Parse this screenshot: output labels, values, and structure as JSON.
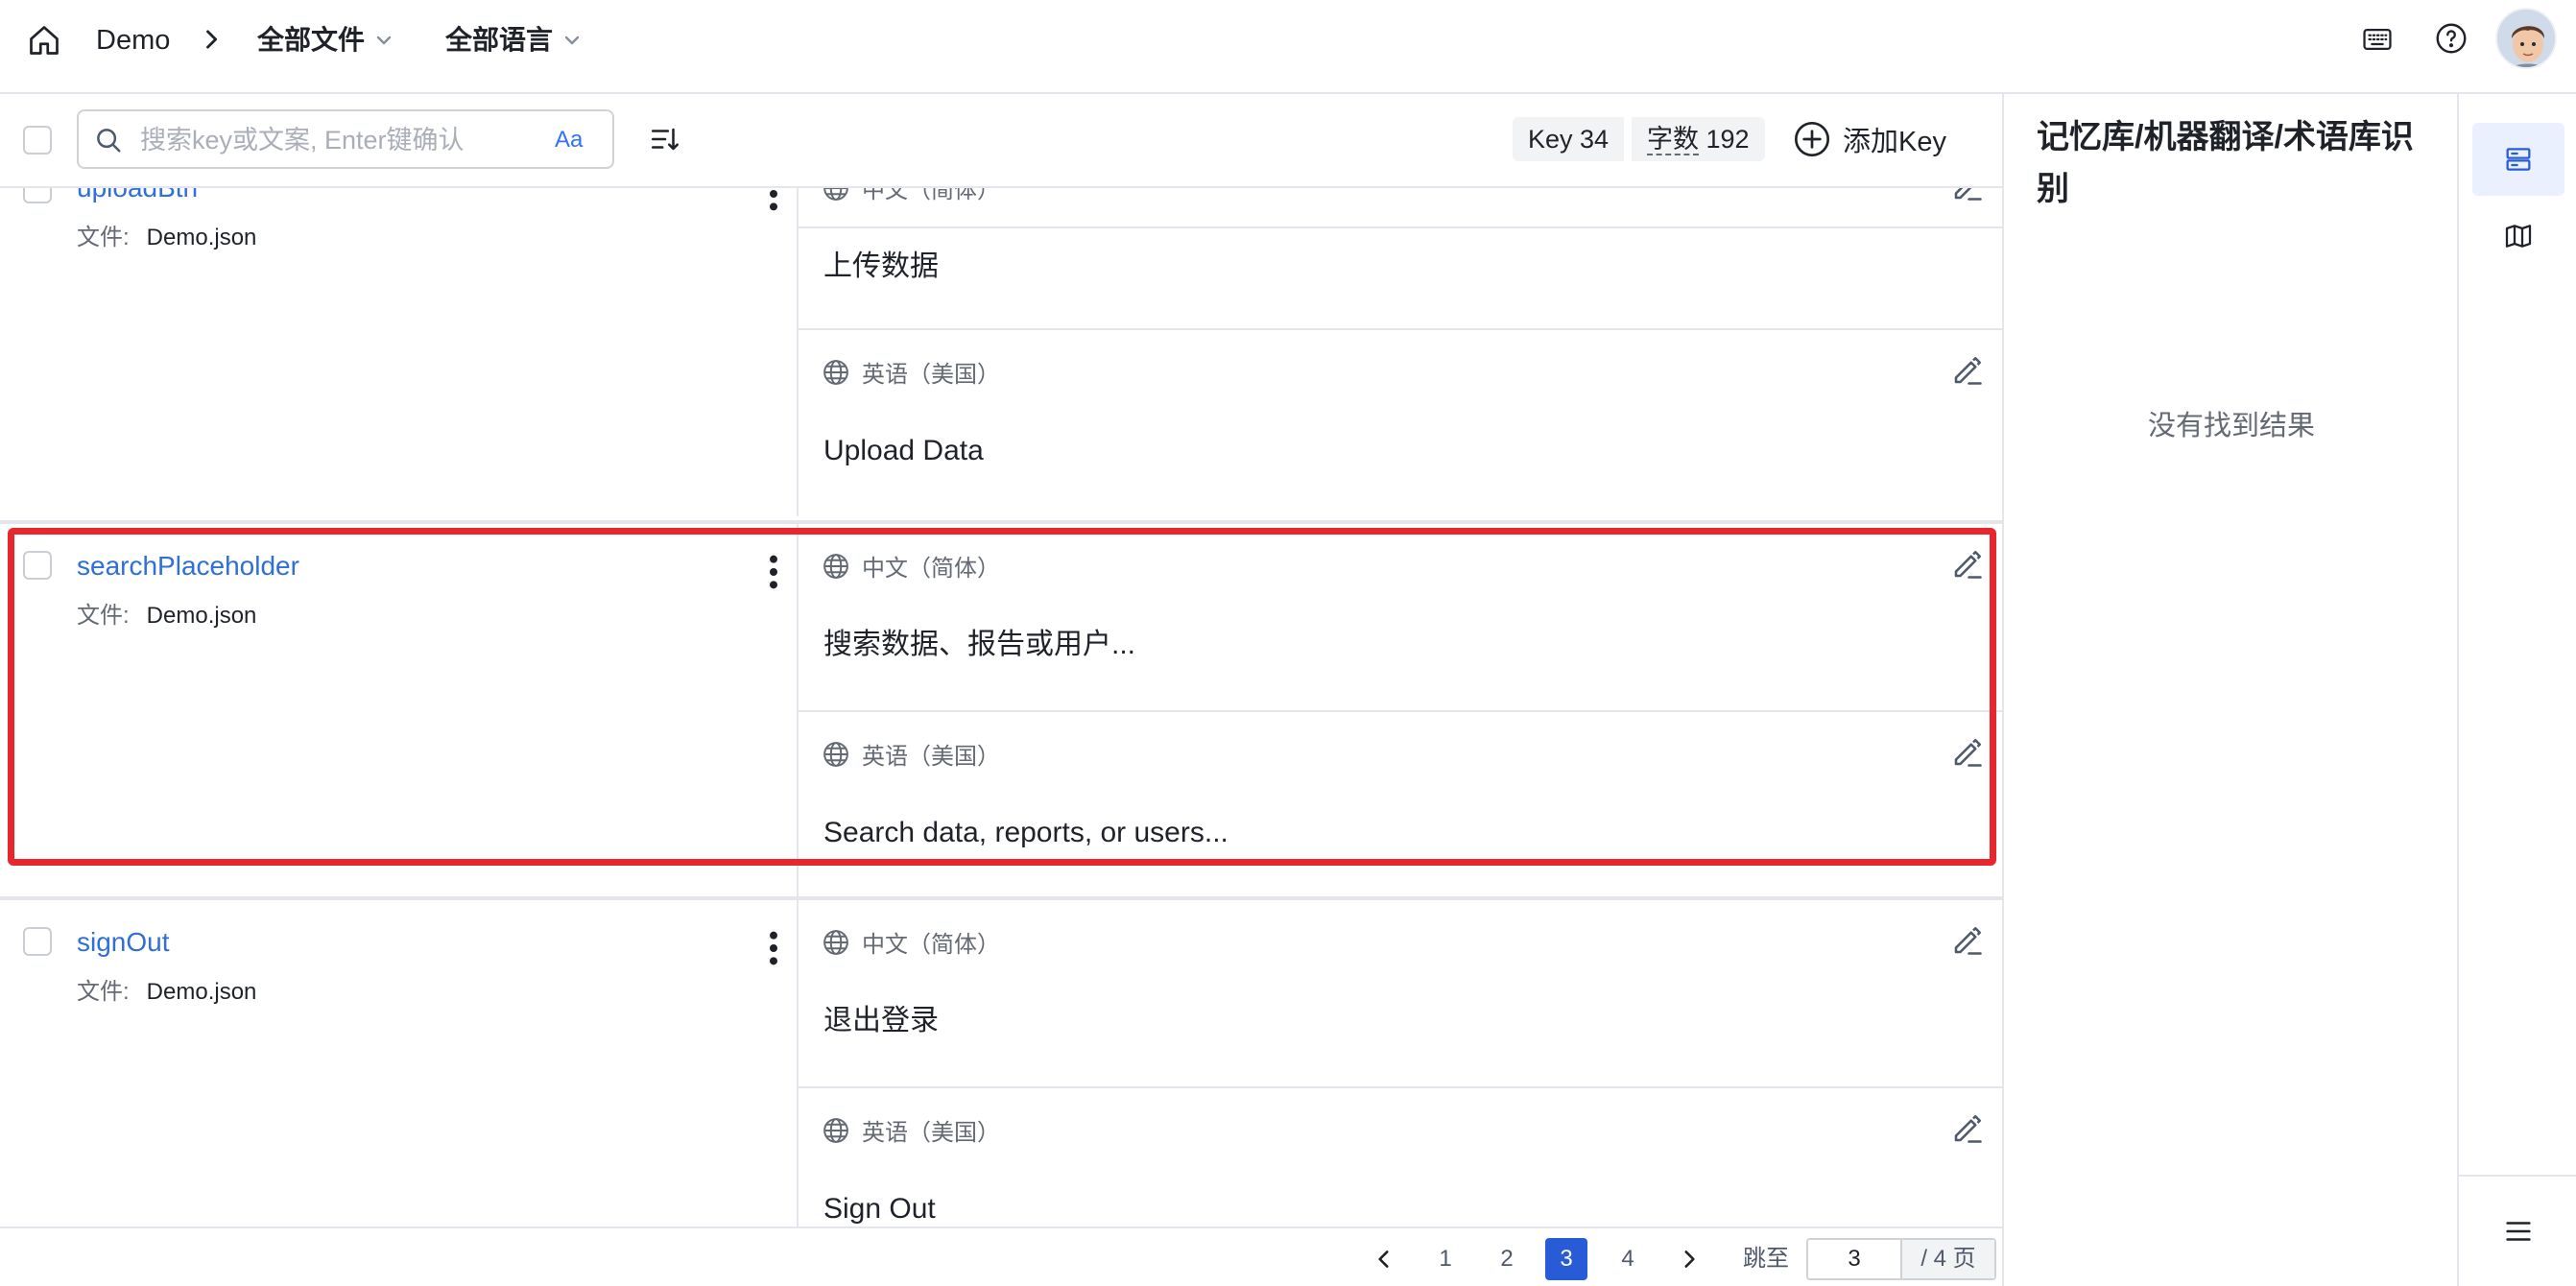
{
  "header": {
    "project": "Demo",
    "files_dropdown": "全部文件",
    "languages_dropdown": "全部语言",
    "icons": [
      "home-icon",
      "chevron-right-icon",
      "chevron-down-icon",
      "keyboard-icon",
      "help-icon",
      "avatar"
    ]
  },
  "toolbar": {
    "search_placeholder": "搜索key或文案, Enter键确认",
    "search_value": "",
    "case_toggle": "Aa",
    "key_count_label": "Key 34",
    "word_count_label": "字数",
    "word_count_value": "192",
    "add_key_label": "添加Key"
  },
  "entries": [
    {
      "key": "uploadBtn",
      "file_label": "文件:",
      "file": "Demo.json",
      "translations": [
        {
          "language": "中文（简体）",
          "text": "上传数据"
        },
        {
          "language": "英语（美国）",
          "text": "Upload Data"
        }
      ]
    },
    {
      "key": "searchPlaceholder",
      "file_label": "文件:",
      "file": "Demo.json",
      "highlighted": true,
      "translations": [
        {
          "language": "中文（简体）",
          "text": "搜索数据、报告或用户..."
        },
        {
          "language": "英语（美国）",
          "text": "Search data, reports, or users..."
        }
      ]
    },
    {
      "key": "signOut",
      "file_label": "文件:",
      "file": "Demo.json",
      "translations": [
        {
          "language": "中文（简体）",
          "text": "退出登录"
        },
        {
          "language": "英语（美国）",
          "text": "Sign Out"
        }
      ]
    }
  ],
  "pagination": {
    "pages": [
      "1",
      "2",
      "3",
      "4"
    ],
    "current": "3",
    "jump_label": "跳至",
    "jump_value": "3",
    "total_label": "/ 4 页"
  },
  "panel": {
    "title": "记忆库/机器翻译/术语库识别",
    "empty_text": "没有找到结果"
  },
  "colors": {
    "accent": "#2a5bd7",
    "key_link": "#2e6fd8",
    "highlight_border": "#e8262d",
    "border": "#e5e6eb",
    "muted_text": "#646a73"
  }
}
